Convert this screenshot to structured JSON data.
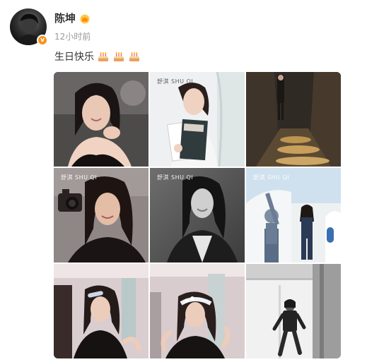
{
  "author": {
    "name": "陈坤",
    "time": "12小时前",
    "verified_icon": "verified-v-badge",
    "crown_icon": "crown-icon"
  },
  "post": {
    "text": "生日快乐",
    "emoji_icons": [
      "cake-icon",
      "cake-icon",
      "cake-icon"
    ]
  },
  "photos": {
    "count": 9,
    "watermark": "舒淇 SHU QI"
  },
  "colors": {
    "name": "#333333",
    "time": "#999999",
    "badge": "#f7931e"
  }
}
